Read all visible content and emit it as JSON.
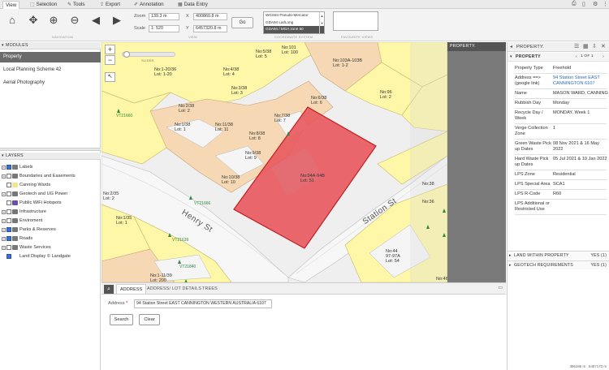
{
  "menu": {
    "tabs": [
      {
        "label": "View",
        "icon": "none"
      },
      {
        "label": "Selection",
        "icon": "selection-icon"
      },
      {
        "label": "Tools",
        "icon": "wrench-icon"
      },
      {
        "label": "Export",
        "icon": "export-icon"
      },
      {
        "label": "Annotation",
        "icon": "pencil-icon"
      },
      {
        "label": "Data Entry",
        "icon": "grid-icon"
      }
    ]
  },
  "toolbar": {
    "navigation_label": "NAVIGATION",
    "view_label": "VIEW",
    "projection_label": "COORDINATE SYSTEM",
    "favourites_label": "FAVOURITE VIEWS",
    "zoom_label": "Zoom",
    "zoom_value": "139.3 m",
    "scale_label": "Scale",
    "scale_value": "1: 520",
    "x_label": "X",
    "x_value": "400860.8 m",
    "y_label": "Y",
    "y_value": "6457320.8 m",
    "go_label": "Go",
    "projections": [
      "WGS84 Pseudo-Mercator",
      "GDA94 Lat/Long",
      "GDA94 / MGA zone 50"
    ],
    "selected_projection": 2
  },
  "modules": {
    "header": "MODULES",
    "items": [
      "Property",
      "Local Planning Scheme 42",
      "Aerial Photography"
    ],
    "active": 0
  },
  "layers": {
    "header": "LAYERS",
    "items": [
      {
        "label": "Labels",
        "checked": true,
        "expand": true,
        "color": "#777777"
      },
      {
        "label": "Boundaries and Easements",
        "checked": false,
        "expand": true,
        "color": "#777777"
      },
      {
        "label": "Canning Wards",
        "checked": false,
        "expand": false,
        "color": "#f0e68c"
      },
      {
        "label": "Geotech and UG Power",
        "checked": false,
        "expand": true,
        "color": "#777777"
      },
      {
        "label": "Public WiFi Hotspots",
        "checked": false,
        "expand": false,
        "color": "#6a4fb3"
      },
      {
        "label": "Infrastructure",
        "checked": false,
        "expand": true,
        "color": "#777777"
      },
      {
        "label": "Enviroment",
        "checked": false,
        "expand": true,
        "color": "#777777"
      },
      {
        "label": "Parks & Reserves",
        "checked": true,
        "expand": true,
        "color": "#777777"
      },
      {
        "label": "Roads",
        "checked": true,
        "expand": true,
        "color": "#777777"
      },
      {
        "label": "Waste Services",
        "checked": false,
        "expand": true,
        "color": "#777777"
      },
      {
        "label": "Land Display © Landgate",
        "checked": true,
        "expand": false,
        "color": "#ffffff"
      }
    ]
  },
  "map": {
    "slider_label": "SLIDER",
    "zoom_in": "+",
    "zoom_out": "−",
    "streets": [
      "Henry St",
      "Station St"
    ],
    "lots": [
      [
        "No:101",
        "Lot: 100"
      ],
      [
        "No:5/38",
        "Lot: 5"
      ],
      [
        "No:103A-103B",
        "Lot: 1-2"
      ],
      [
        "No:1-20/36",
        "Lot: 1-20"
      ],
      [
        "No:4/38",
        "Lot: 4"
      ],
      [
        "No:3/38",
        "Lot: 3"
      ],
      [
        "No:6/38",
        "Lot: 6"
      ],
      [
        "No:96",
        "Lot: 2"
      ],
      [
        "No:2/38",
        "Lot: 2"
      ],
      [
        "No:7/38",
        "Lot: 7"
      ],
      [
        "No:1/38",
        "Lot: 1"
      ],
      [
        "No:11/38",
        "Lot: 11"
      ],
      [
        "No:8/38",
        "Lot: 8"
      ],
      [
        "No:9/38",
        "Lot: 9"
      ],
      [
        "No:94A-94B",
        "Lot: 51"
      ],
      [
        "No:10/38",
        "Lot: 10"
      ],
      [
        "No:2/35",
        "Lot: 2"
      ],
      [
        "No:1/35",
        "Lot: 1"
      ],
      [
        "No:44",
        "97-97A",
        "Lot: 54"
      ],
      [
        "No:1-11/39",
        "Lot: 200"
      ]
    ],
    "trees": [
      "VT21660",
      "VT21666",
      "VT21639",
      "VT21840"
    ],
    "stray": [
      "No:38",
      "No:36",
      "No:46"
    ],
    "colors": {
      "yellow": "#fdf7a7",
      "tan": "#f6d9b4",
      "road": "#f3f3f3",
      "selected": "#e8545a",
      "selected_stroke": "#c21e22"
    }
  },
  "bottom": {
    "tabs": [
      "ADDRESS",
      "ADDRESS/ LOT DETAILS",
      "TREES"
    ],
    "active_tab": 0,
    "address_label": "Address",
    "required_mark": "*",
    "address_value": "94 Station Street EAST CANNINGTON  WESTERN AUSTRALIA  6107",
    "search_label": "Search",
    "clear_label": "Clear"
  },
  "property": {
    "dark_header": "PROPERTY.",
    "title": "PROPERTY.",
    "section": "PROPERTY",
    "pager": "1 OF 1",
    "rows": [
      {
        "k": "Property Type",
        "v": "Freehold"
      },
      {
        "k": "Address ==> (google link)",
        "v": "94 Station Street EAST CANNINGTON 6107",
        "link": true
      },
      {
        "k": "Name",
        "v": "MASON WARD, CANNING"
      },
      {
        "k": "Rubbish Day",
        "v": "Monday"
      },
      {
        "k": "Recycle Day / Week",
        "v": "MONDAY, Week 1"
      },
      {
        "k": "Verge Collection Zone",
        "v": "1"
      },
      {
        "k": "Green Waste Pick up Dates",
        "v": "08 Nov 2021 & 16 May 2022"
      },
      {
        "k": "Hard Waste Pick up Dates",
        "v": "05 Jul 2021 & 10 Jan 2022"
      },
      {
        "k": "LPS Zone",
        "v": "Residential"
      },
      {
        "k": "LPS Special Area",
        "v": "SCA1"
      },
      {
        "k": "LPS R-Code",
        "v": "R60"
      },
      {
        "k": "LPS Additional or Restricted Use",
        "v": ""
      }
    ],
    "land_within": "LAND WITHIN PROPERTY",
    "land_within_count": "YES (1)",
    "geotech": "GEOTECH REQUIREMENTS",
    "geotech_count": "YES (1)"
  },
  "status": {
    "x": "386185 m",
    "y": "6457173 m"
  }
}
